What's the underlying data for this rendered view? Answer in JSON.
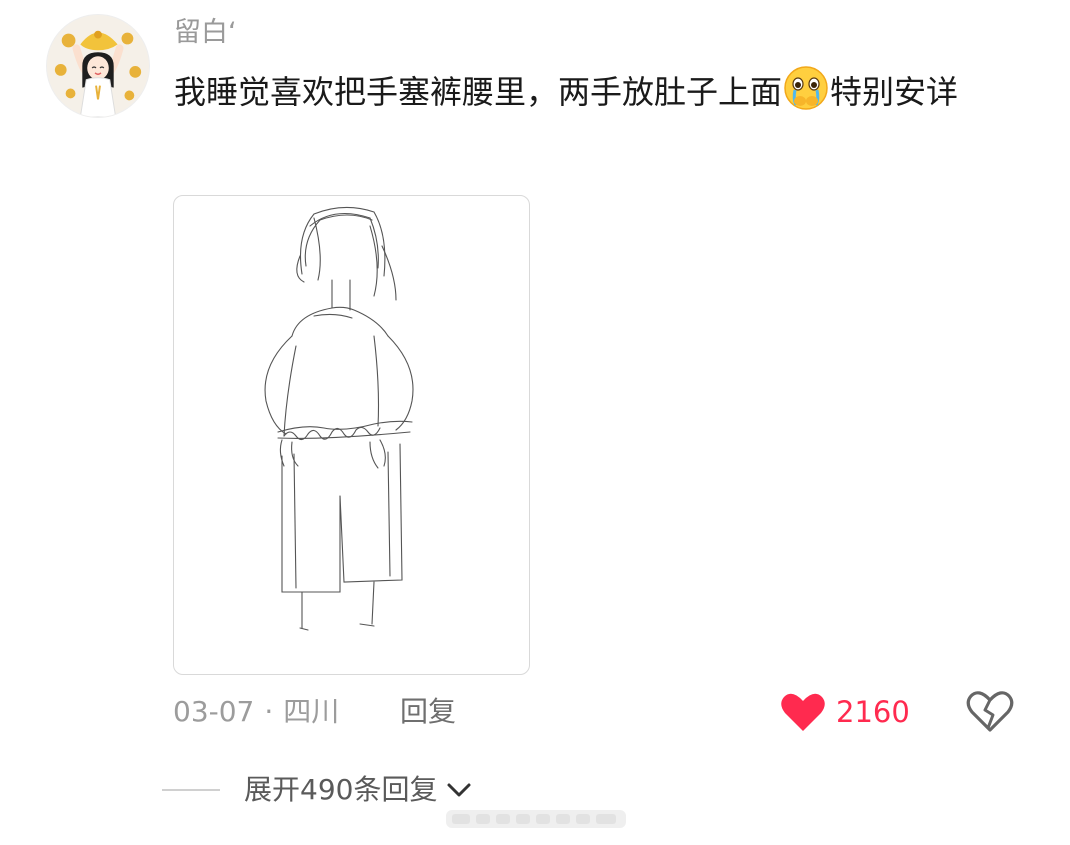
{
  "comment": {
    "username": "留白‘",
    "text_part1": "我睡觉喜欢把手塞裤腰里，两手放肚子上面",
    "emoji": "crying-face-emoji",
    "text_part2": "特别安详",
    "date": "03-07",
    "separator": "·",
    "location": "四川",
    "reply_label": "回复",
    "like_count": "2160",
    "expand_replies_label": "展开490条回复"
  },
  "icons": {
    "like": "heart-icon",
    "dislike": "broken-heart-icon",
    "expand": "chevron-down-icon"
  },
  "colors": {
    "like_red": "#ff2a4f",
    "meta_gray": "#9c9c9c"
  }
}
